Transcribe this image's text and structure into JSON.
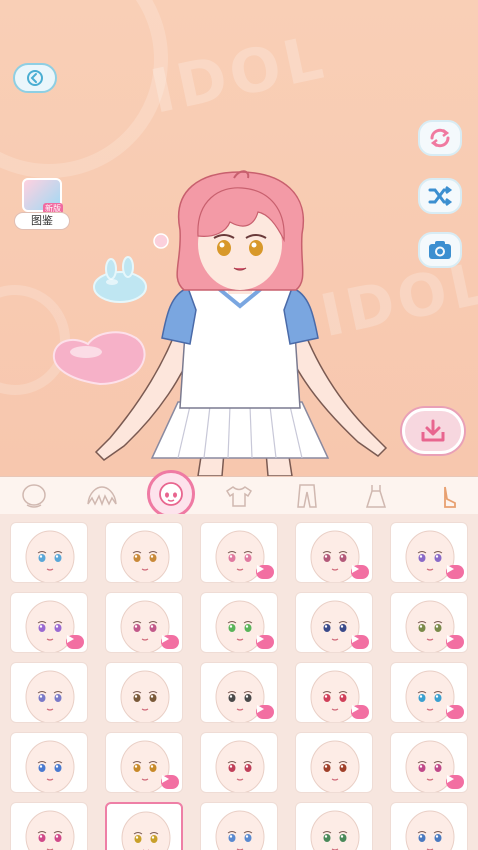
{
  "watermark": {
    "text": "IDOL"
  },
  "left_panel": {
    "gallery_label": "图鉴",
    "gallery_tag": "新版"
  },
  "tabs": [
    {
      "id": "head",
      "icon": "head-outline-icon",
      "active": false
    },
    {
      "id": "hair",
      "icon": "hair-icon",
      "active": false
    },
    {
      "id": "face",
      "icon": "face-icon",
      "active": true
    },
    {
      "id": "top",
      "icon": "shirt-icon",
      "active": false
    },
    {
      "id": "pants",
      "icon": "pants-icon",
      "active": false
    },
    {
      "id": "dress",
      "icon": "dress-icon",
      "active": false
    },
    {
      "id": "more",
      "icon": "shoe-icon",
      "active": false
    }
  ],
  "faces": [
    {
      "eye": "#5aa7d8",
      "video": false
    },
    {
      "eye": "#c98a3a",
      "video": false
    },
    {
      "eye": "#e07aa0",
      "video": true
    },
    {
      "eye": "#b45a7a",
      "video": true
    },
    {
      "eye": "#8a6ac8",
      "video": true
    },
    {
      "eye": "#9a6ad2",
      "video": true
    },
    {
      "eye": "#c25a8a",
      "video": true
    },
    {
      "eye": "#5ab45a",
      "video": true
    },
    {
      "eye": "#3a4a8a",
      "video": true
    },
    {
      "eye": "#7a8a4a",
      "video": true
    },
    {
      "eye": "#7a7ac8",
      "video": false
    },
    {
      "eye": "#7a5a3a",
      "video": false
    },
    {
      "eye": "#4a4a4a",
      "video": true
    },
    {
      "eye": "#d0405a",
      "video": true
    },
    {
      "eye": "#3aa0d0",
      "video": true
    },
    {
      "eye": "#4a7ad0",
      "video": false
    },
    {
      "eye": "#c88a2a",
      "video": true
    },
    {
      "eye": "#c0405a",
      "video": false
    },
    {
      "eye": "#a0402a",
      "video": false
    },
    {
      "eye": "#c04a8a",
      "video": true
    },
    {
      "eye": "#d04a8a",
      "video": false
    },
    {
      "eye": "#c8a02a",
      "video": false
    },
    {
      "eye": "#5a8ad0",
      "video": false
    },
    {
      "eye": "#4a8a5a",
      "video": false
    },
    {
      "eye": "#4a7ac0",
      "video": false
    }
  ],
  "selected_index": 21,
  "colors": {
    "accent_pink": "#f26fa2",
    "outline_blue": "#8ecfe3",
    "background": "#f7c7ae"
  }
}
